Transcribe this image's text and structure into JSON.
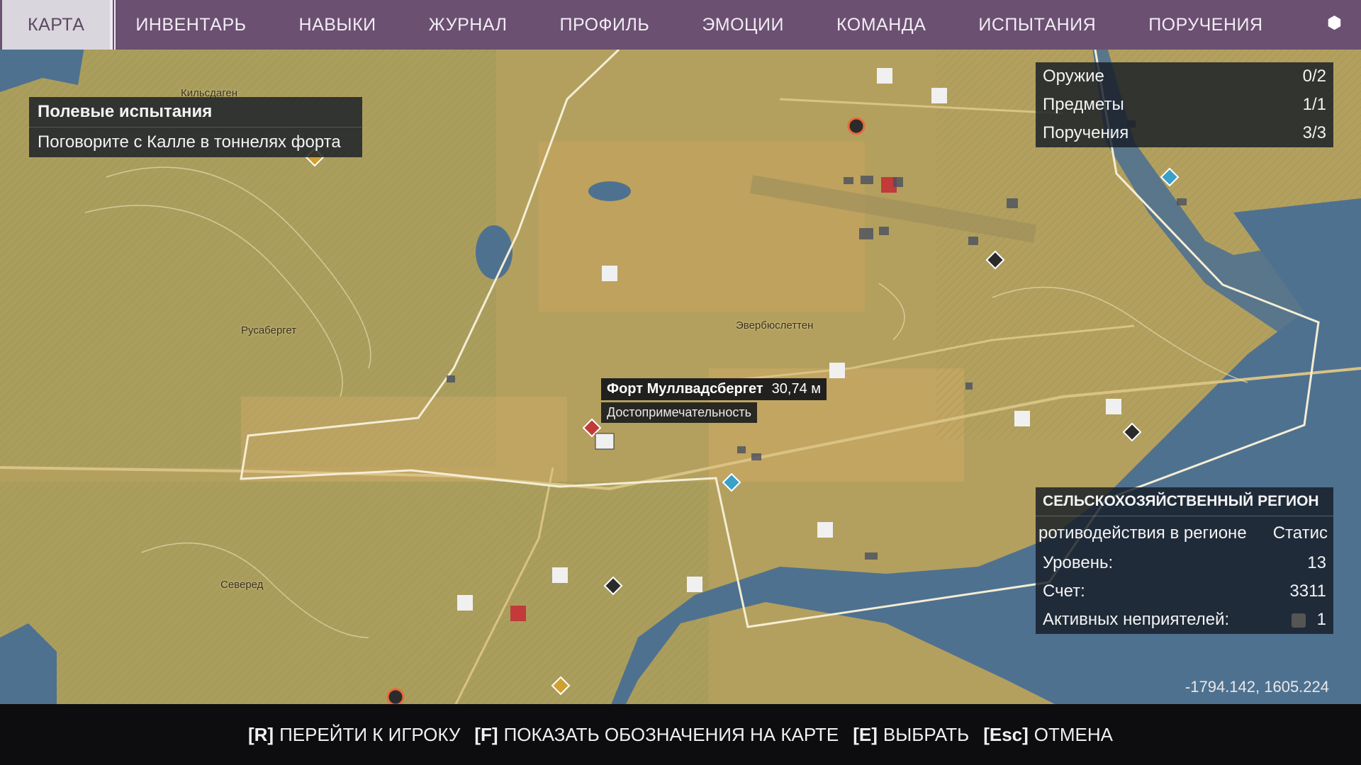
{
  "nav": {
    "tabs": [
      {
        "label": "КАРТА",
        "active": true
      },
      {
        "label": "ИНВЕНТАРЬ"
      },
      {
        "label": "НАВЫКИ"
      },
      {
        "label": "ЖУРНАЛ"
      },
      {
        "label": "ПРОФИЛЬ"
      },
      {
        "label": "ЭМОЦИИ"
      },
      {
        "label": "КОМАНДА"
      },
      {
        "label": "ИСПЫТАНИЯ"
      },
      {
        "label": "ПОРУЧЕНИЯ"
      }
    ],
    "corner_icon": "hexagon-icon"
  },
  "quest": {
    "title": "Полевые испытания",
    "description": "Поговорите с Калле в тоннелях форта"
  },
  "stats": {
    "rows": [
      {
        "label": "Оружие",
        "value": "0/2"
      },
      {
        "label": "Предметы",
        "value": "1/1"
      },
      {
        "label": "Поручения",
        "value": "3/3"
      }
    ]
  },
  "region": {
    "title": "СЕЛЬСКОХОЗЯЙСТВЕННЫЙ РЕГИОН",
    "sub_left": "ротиводействия в регионе",
    "sub_right": "Статис",
    "level_label": "Уровень:",
    "level_value": "13",
    "score_label": "Счет:",
    "score_value": "3311",
    "enemies_label": "Активных неприятелей:",
    "enemies_value": "1"
  },
  "tooltip": {
    "name": "Форт Муллвадсбергет",
    "distance": "30,74 м",
    "type": "Достопримечательность"
  },
  "places": {
    "kilsdagen": "Кильсдаген",
    "rusaberget": "Русабергет",
    "everbyusletten": "Эвербюслеттен",
    "svered": "Северед"
  },
  "coords": "-1794.142, 1605.224",
  "hints": [
    {
      "key": "[R]",
      "label": "ПЕРЕЙТИ К ИГРОКУ"
    },
    {
      "key": "[F]",
      "label": "ПОКАЗАТЬ ОБОЗНАЧЕНИЯ НА КАРТЕ"
    },
    {
      "key": "[E]",
      "label": "ВЫБРАТЬ"
    },
    {
      "key": "[Esc]",
      "label": "ОТМЕНА"
    }
  ],
  "colors": {
    "topbar": "#6b5072",
    "terrain": "#b09a5a",
    "water": "#4f7190",
    "border_line": "#f4edd4"
  }
}
